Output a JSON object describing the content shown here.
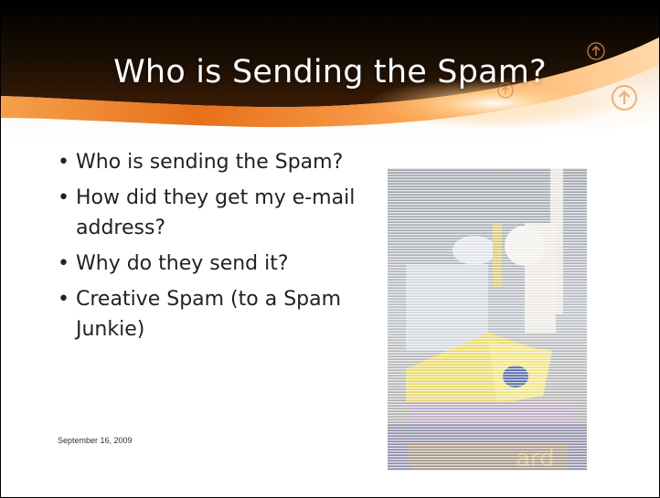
{
  "slide": {
    "title": "Who is Sending the Spam?",
    "bullets": [
      "Who is sending the Spam?",
      "How did they get my e-mail address?",
      "Why do they send it?",
      "Creative Spam (to a Spam Junkie)"
    ],
    "footer_date": "September 16, 2009"
  },
  "theme": {
    "header_dark": "#1a0f05",
    "header_orange": "#e8701a",
    "accent_orange": "#f7a24a",
    "text_color": "#222222"
  },
  "icons": [
    "up-arrow-circle-icon",
    "up-arrow-circle-icon",
    "up-arrow-circle-icon"
  ]
}
